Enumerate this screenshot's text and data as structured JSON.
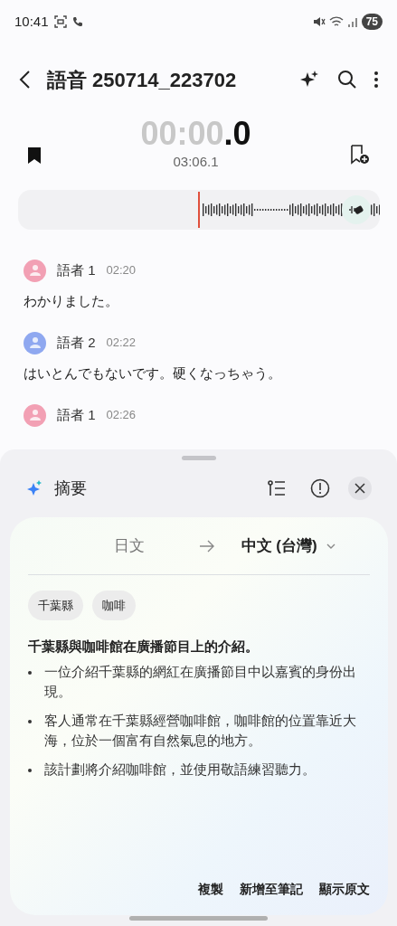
{
  "status_bar": {
    "time": "10:41",
    "battery": "75"
  },
  "header": {
    "title": "語音 250714_223702"
  },
  "player": {
    "elapsed_main": "00:00",
    "elapsed_fraction": ".0",
    "duration": "03:06.1"
  },
  "transcript": [
    {
      "speaker": "語者 1",
      "time": "02:20",
      "text": "わかりました。",
      "color": "#f2a0b4"
    },
    {
      "speaker": "語者 2",
      "time": "02:22",
      "text": "はいとんでもないです。硬くなっちゃう。",
      "color": "#8fa8f0"
    },
    {
      "speaker": "語者 1",
      "time": "02:26",
      "color": "#f2a0b4"
    }
  ],
  "summary": {
    "title": "摘要",
    "source_language": "日文",
    "target_language": "中文 (台灣)",
    "tags": [
      "千葉縣",
      "咖啡"
    ],
    "heading": "千葉縣與咖啡館在廣播節目上的介紹。",
    "bullets": [
      "一位介紹千葉縣的網紅在廣播節目中以嘉賓的身份出現。",
      "客人通常在千葉縣經營咖啡館，咖啡館的位置靠近大海，位於一個富有自然氣息的地方。",
      "該計劃將介紹咖啡館，並使用敬語練習聽力。"
    ],
    "actions": [
      "複製",
      "新增至筆記",
      "顯示原文"
    ]
  }
}
